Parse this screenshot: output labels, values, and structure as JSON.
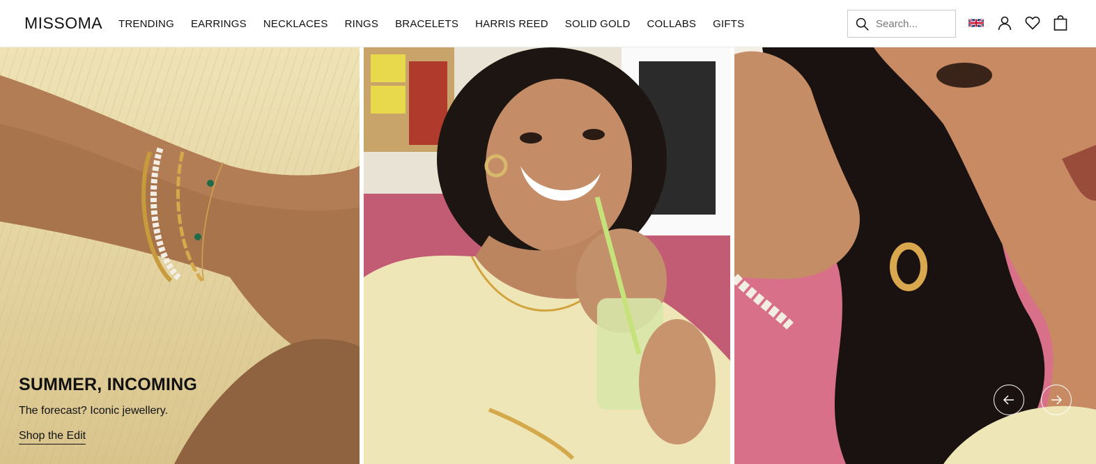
{
  "header": {
    "logo": "MISSOMA",
    "nav": [
      "TRENDING",
      "EARRINGS",
      "NECKLACES",
      "RINGS",
      "BRACELETS",
      "HARRIS REED",
      "SOLID GOLD",
      "COLLABS",
      "GIFTS"
    ],
    "search_placeholder": "Search...",
    "icons": [
      "search-icon",
      "uk-flag-icon",
      "account-icon",
      "heart-icon",
      "bag-icon"
    ]
  },
  "hero": {
    "title": "SUMMER, INCOMING",
    "subtitle": "The forecast? Iconic jewellery.",
    "link": "Shop the Edit",
    "panels": [
      "bracelets-stack-photo",
      "smiling-woman-drink-photo",
      "hoop-earring-closeup-photo"
    ],
    "controls": [
      "previous-arrow-icon",
      "next-arrow-icon"
    ]
  },
  "colors": {
    "panel_1": "#e8d9a6",
    "panel_2": "#c65a73",
    "panel_3": "#d86b86"
  }
}
